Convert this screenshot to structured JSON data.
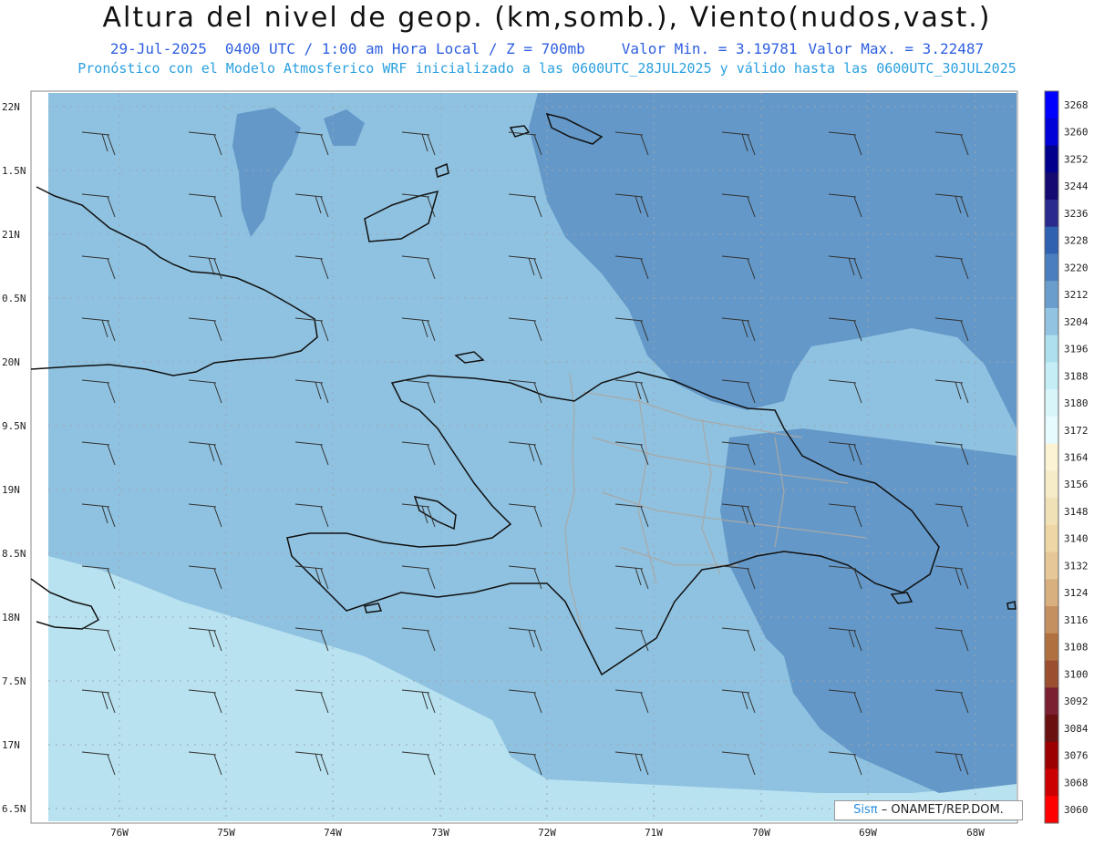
{
  "header": {
    "title": "Altura del nivel de geop. (km,somb.), Viento(nudos,vast.)",
    "date": "29-Jul-2025",
    "time": "0400 UTC / 1:00 am Hora Local / Z = 700mb",
    "min": "Valor Min. = 3.19781",
    "max": "Valor Max. = 3.22487",
    "run": "Pronóstico con el Modelo Atmosferico WRF inicializado a las 0600UTC_28JUL2025 y válido hasta las  0600UTC_30JUL2025"
  },
  "map": {
    "lat_labels": [
      "22N",
      "1.5N",
      "21N",
      "0.5N",
      "20N",
      "9.5N",
      "19N",
      "8.5N",
      "18N",
      "7.5N",
      "17N",
      "6.5N"
    ],
    "lon_labels": [
      "76W",
      "75W",
      "74W",
      "73W",
      "72W",
      "71W",
      "70W",
      "69W",
      "68W"
    ],
    "colors": {
      "shade_low": "#b8e2f0",
      "shade_mid": "#8fc2e0",
      "shade_high": "#6498c8",
      "coast": "#111111",
      "borders": "#a8a8a8",
      "barbs": "#333333"
    }
  },
  "colorbar": {
    "levels": [
      "3268",
      "3260",
      "3252",
      "3244",
      "3236",
      "3228",
      "3220",
      "3212",
      "3204",
      "3196",
      "3188",
      "3180",
      "3172",
      "3164",
      "3156",
      "3148",
      "3140",
      "3132",
      "3124",
      "3116",
      "3108",
      "3100",
      "3092",
      "3084",
      "3076",
      "3068",
      "3060"
    ],
    "colors": [
      "#0000ff",
      "#0000d8",
      "#00008c",
      "#140a70",
      "#2a2a8c",
      "#3060b0",
      "#4a7fbe",
      "#6a9ccc",
      "#92c4e2",
      "#aedfee",
      "#c4edf6",
      "#d8f6fa",
      "#e6fbfd",
      "#fbf3d4",
      "#f6ecc8",
      "#f0e2b6",
      "#eed6a6",
      "#e6c898",
      "#d8b080",
      "#c49060",
      "#b07040",
      "#9a5030",
      "#7a2030",
      "#6a1010",
      "#9c0000",
      "#cc0000",
      "#ff0000"
    ]
  },
  "watermark": {
    "logo": "Sisπ",
    "text": "– ONAMET/REP.DOM."
  }
}
